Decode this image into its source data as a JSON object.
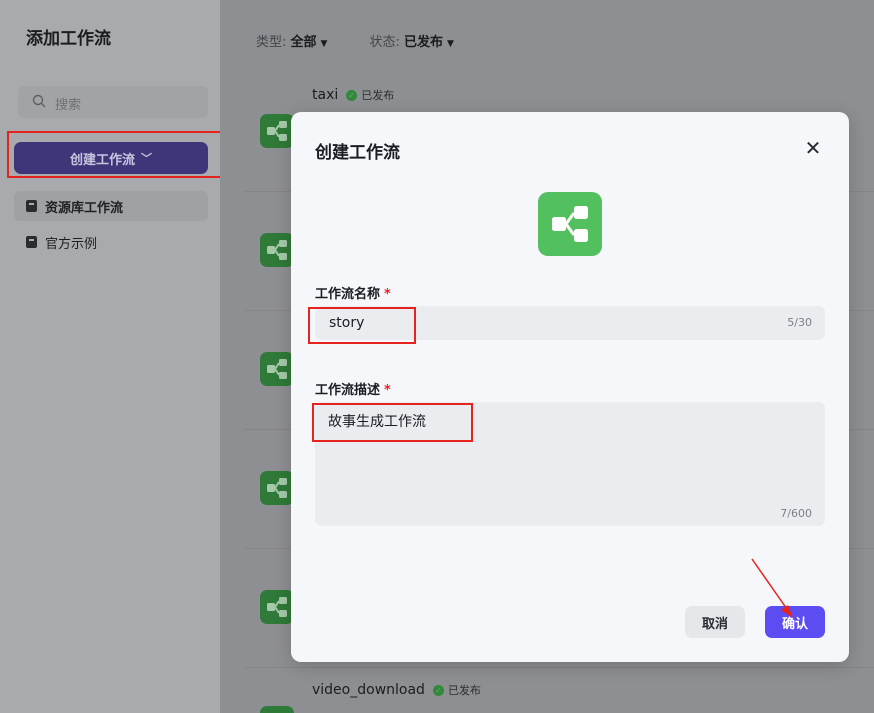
{
  "sidebar": {
    "title": "添加工作流",
    "search_placeholder": "搜索",
    "create_button": "创建工作流",
    "items": [
      {
        "label": "资源库工作流",
        "active": true
      },
      {
        "label": "官方示例",
        "active": false
      }
    ]
  },
  "filters": {
    "type_label": "类型:",
    "type_value": "全部",
    "status_label": "状态:",
    "status_value": "已发布"
  },
  "workflows": [
    {
      "name": "taxi",
      "status": "已发布"
    },
    {
      "name": "video_download",
      "status": "已发布"
    }
  ],
  "modal": {
    "title": "创建工作流",
    "name_label": "工作流名称",
    "name_value": "story",
    "name_count": "5/30",
    "desc_label": "工作流描述",
    "desc_value": "故事生成工作流",
    "desc_count": "7/600",
    "required_mark": "*",
    "cancel_label": "取消",
    "confirm_label": "确认"
  },
  "colors": {
    "accent": "#5b4df1",
    "icon_green": "#53c05f",
    "annotation_red": "#e6241d"
  }
}
